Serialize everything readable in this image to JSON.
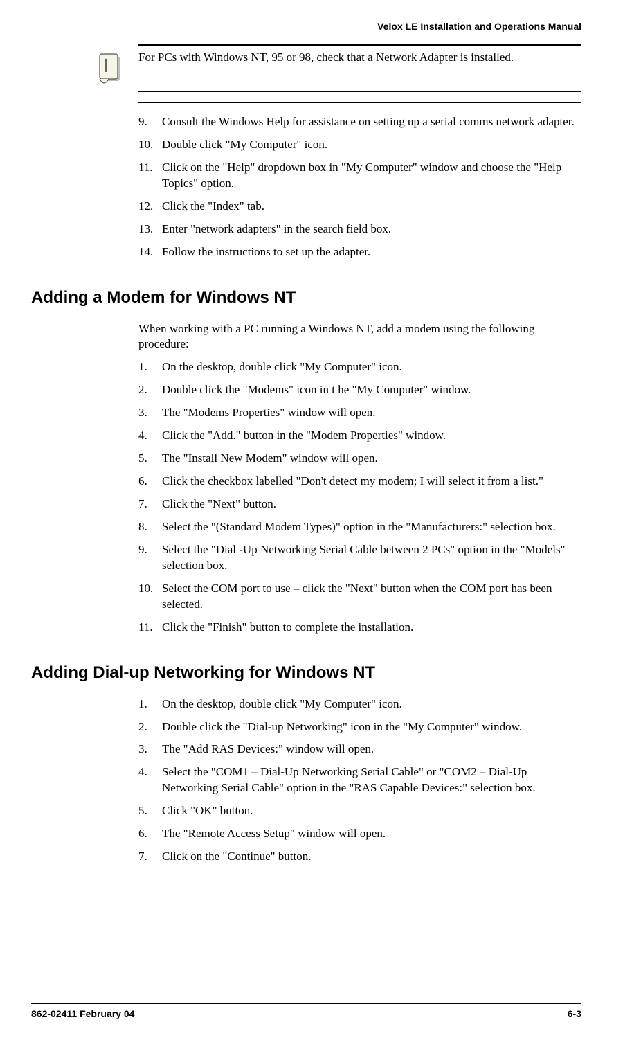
{
  "header": {
    "title": "Velox LE Installation and Operations Manual"
  },
  "note": {
    "text": "For PCs with Windows NT, 95 or 98, check that a Network Adapter is installed."
  },
  "top_steps": [
    {
      "num": "9.",
      "text": "Consult the Windows Help for assistance on setting up a serial comms network adapter."
    },
    {
      "num": "10.",
      "text": "Double click \"My Computer\" icon."
    },
    {
      "num": "11.",
      "text": "Click on the \"Help\" dropdown box in \"My Computer\" window and choose the \"Help Topics\" option."
    },
    {
      "num": "12.",
      "text": "Click the \"Index\" tab."
    },
    {
      "num": "13.",
      "text": "Enter \"network adapters\" in the search field box."
    },
    {
      "num": "14.",
      "text": "Follow the instructions to set up the adapter."
    }
  ],
  "section1": {
    "heading": "Adding a Modem for Windows NT",
    "intro": "When working with a PC running a Windows NT, add a modem using the following procedure:",
    "steps": [
      {
        "num": "1.",
        "text": "On the desktop, double click \"My Computer\" icon."
      },
      {
        "num": "2.",
        "text": "Double click the \"Modems\" icon in t he \"My Computer\" window."
      },
      {
        "num": "3.",
        "text": "The \"Modems Properties\" window will open."
      },
      {
        "num": "4.",
        "text": "Click the \"Add.\" button in the \"Modem Properties\" window."
      },
      {
        "num": "5.",
        "text": "The \"Install New Modem\" window will open."
      },
      {
        "num": "6.",
        "text": "Click the checkbox labelled \"Don't detect my modem; I will select it from a list.\""
      },
      {
        "num": "7.",
        "text": "Click the \"Next\" button."
      },
      {
        "num": "8.",
        "text": "Select the \"(Standard Modem Types)\" option in the \"Manufacturers:\" selection box."
      },
      {
        "num": "9.",
        "text": "Select the \"Dial -Up Networking Serial Cable between 2 PCs\" option in the \"Models\" selection box."
      },
      {
        "num": "10.",
        "text": "Select the COM port to use  – click the \"Next\" button when the COM port has been selected."
      },
      {
        "num": "11.",
        "text": "Click the \"Finish\" button to complete the installation."
      }
    ]
  },
  "section2": {
    "heading": "Adding Dial-up Networking for Windows NT",
    "steps": [
      {
        "num": "1.",
        "text": "On the desktop, double click \"My Computer\" icon."
      },
      {
        "num": "2.",
        "text": "Double click the \"Dial-up Networking\" icon in the \"My Computer\" window."
      },
      {
        "num": "3.",
        "text": "The \"Add RAS Devices:\" window will open."
      },
      {
        "num": "4.",
        "text": "Select the \"COM1 – Dial-Up Networking Serial Cable\" or \"COM2 – Dial-Up Networking Serial Cable\" option in the \"RAS Capable Devices:\" selection box."
      },
      {
        "num": "5.",
        "text": "Click \"OK\" button."
      },
      {
        "num": "6.",
        "text": "The \"Remote Access Setup\" window will open."
      },
      {
        "num": "7.",
        "text": "Click on the \"Continue\" button."
      }
    ]
  },
  "footer": {
    "left": "862-02411 February 04",
    "right": "6-3"
  }
}
